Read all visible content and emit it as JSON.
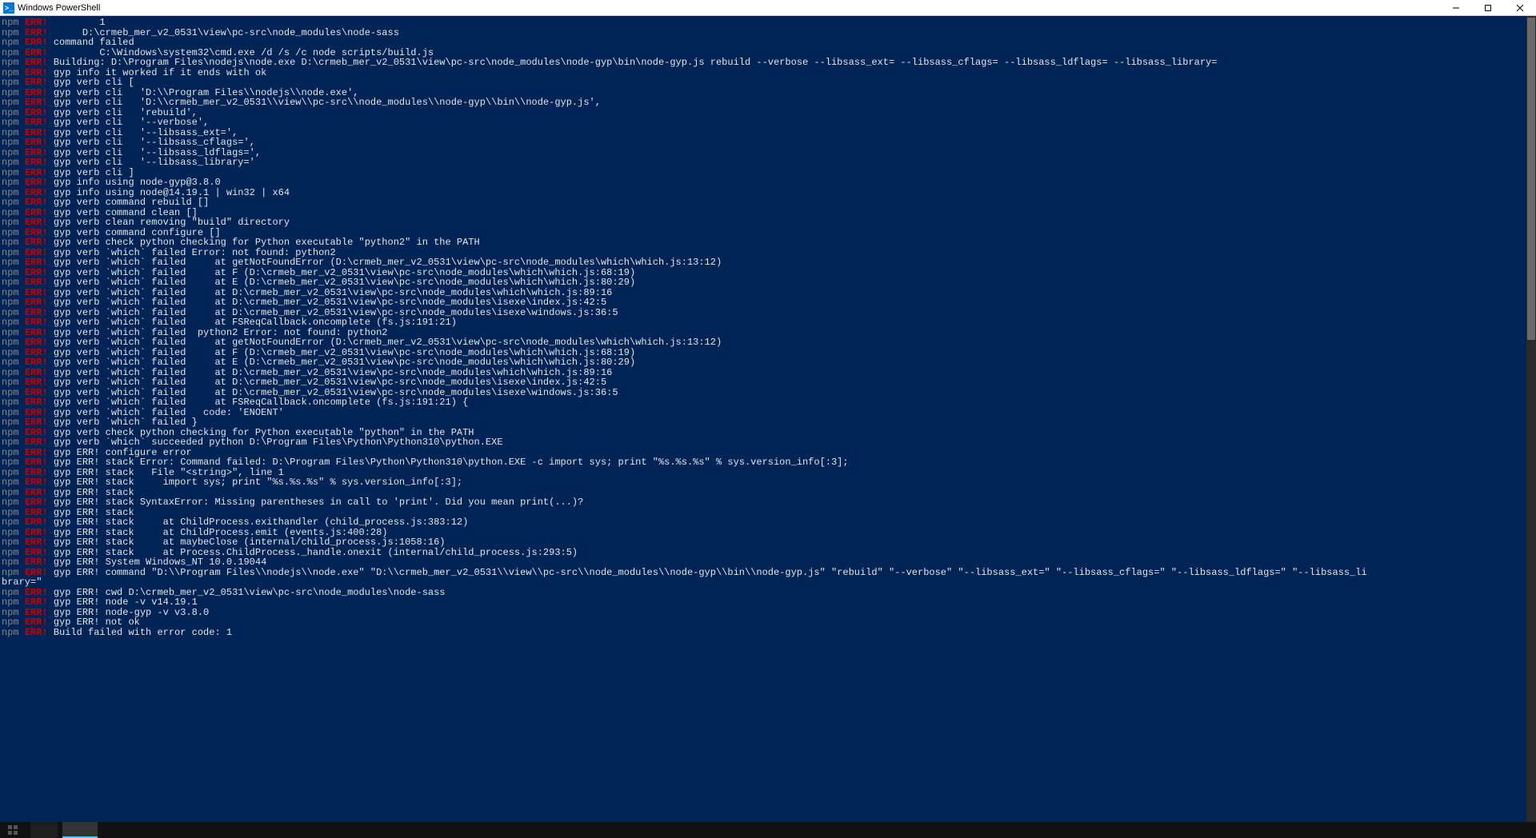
{
  "window": {
    "title": "Windows PowerShell",
    "icon_label": ">_"
  },
  "colors": {
    "terminal_bg": "#012456",
    "npm_gray": "#888888",
    "err_red": "#cc0000",
    "text": "#e5e5e5"
  },
  "prefix": {
    "npm": "npm",
    "err": "ERR!"
  },
  "lines": [
    {
      "t": "npmerr",
      "body": "         1"
    },
    {
      "t": "npmerr",
      "body": "      D:\\crmeb_mer_v2_0531\\view\\pc-src\\node_modules\\node-sass"
    },
    {
      "t": "npmerr",
      "body": " command failed"
    },
    {
      "t": "npmerr",
      "body": "         C:\\Windows\\system32\\cmd.exe /d /s /c node scripts/build.js"
    },
    {
      "t": "npmerr",
      "body": " Building: D:\\Program Files\\nodejs\\node.exe D:\\crmeb_mer_v2_0531\\view\\pc-src\\node_modules\\node-gyp\\bin\\node-gyp.js rebuild --verbose --libsass_ext= --libsass_cflags= --libsass_ldflags= --libsass_library="
    },
    {
      "t": "npmerr",
      "body": " gyp info it worked if it ends with ok"
    },
    {
      "t": "npmerr",
      "body": " gyp verb cli ["
    },
    {
      "t": "npmerr",
      "body": " gyp verb cli   'D:\\\\Program Files\\\\nodejs\\\\node.exe',"
    },
    {
      "t": "npmerr",
      "body": " gyp verb cli   'D:\\\\crmeb_mer_v2_0531\\\\view\\\\pc-src\\\\node_modules\\\\node-gyp\\\\bin\\\\node-gyp.js',"
    },
    {
      "t": "npmerr",
      "body": " gyp verb cli   'rebuild',"
    },
    {
      "t": "npmerr",
      "body": " gyp verb cli   '--verbose',"
    },
    {
      "t": "npmerr",
      "body": " gyp verb cli   '--libsass_ext=',"
    },
    {
      "t": "npmerr",
      "body": " gyp verb cli   '--libsass_cflags=',"
    },
    {
      "t": "npmerr",
      "body": " gyp verb cli   '--libsass_ldflags=',"
    },
    {
      "t": "npmerr",
      "body": " gyp verb cli   '--libsass_library='"
    },
    {
      "t": "npmerr",
      "body": " gyp verb cli ]"
    },
    {
      "t": "npmerr",
      "body": " gyp info using node-gyp@3.8.0"
    },
    {
      "t": "npmerr",
      "body": " gyp info using node@14.19.1 | win32 | x64"
    },
    {
      "t": "npmerr",
      "body": " gyp verb command rebuild []"
    },
    {
      "t": "npmerr",
      "body": " gyp verb command clean []"
    },
    {
      "t": "npmerr",
      "body": " gyp verb clean removing \"build\" directory"
    },
    {
      "t": "npmerr",
      "body": " gyp verb command configure []"
    },
    {
      "t": "npmerr",
      "body": " gyp verb check python checking for Python executable \"python2\" in the PATH"
    },
    {
      "t": "npmerr",
      "body": " gyp verb `which` failed Error: not found: python2"
    },
    {
      "t": "npmerr",
      "body": " gyp verb `which` failed     at getNotFoundError (D:\\crmeb_mer_v2_0531\\view\\pc-src\\node_modules\\which\\which.js:13:12)"
    },
    {
      "t": "npmerr",
      "body": " gyp verb `which` failed     at F (D:\\crmeb_mer_v2_0531\\view\\pc-src\\node_modules\\which\\which.js:68:19)"
    },
    {
      "t": "npmerr",
      "body": " gyp verb `which` failed     at E (D:\\crmeb_mer_v2_0531\\view\\pc-src\\node_modules\\which\\which.js:80:29)"
    },
    {
      "t": "npmerr",
      "body": " gyp verb `which` failed     at D:\\crmeb_mer_v2_0531\\view\\pc-src\\node_modules\\which\\which.js:89:16"
    },
    {
      "t": "npmerr",
      "body": " gyp verb `which` failed     at D:\\crmeb_mer_v2_0531\\view\\pc-src\\node_modules\\isexe\\index.js:42:5"
    },
    {
      "t": "npmerr",
      "body": " gyp verb `which` failed     at D:\\crmeb_mer_v2_0531\\view\\pc-src\\node_modules\\isexe\\windows.js:36:5"
    },
    {
      "t": "npmerr",
      "body": " gyp verb `which` failed     at FSReqCallback.oncomplete (fs.js:191:21)"
    },
    {
      "t": "npmerr",
      "body": " gyp verb `which` failed  python2 Error: not found: python2"
    },
    {
      "t": "npmerr",
      "body": " gyp verb `which` failed     at getNotFoundError (D:\\crmeb_mer_v2_0531\\view\\pc-src\\node_modules\\which\\which.js:13:12)"
    },
    {
      "t": "npmerr",
      "body": " gyp verb `which` failed     at F (D:\\crmeb_mer_v2_0531\\view\\pc-src\\node_modules\\which\\which.js:68:19)"
    },
    {
      "t": "npmerr",
      "body": " gyp verb `which` failed     at E (D:\\crmeb_mer_v2_0531\\view\\pc-src\\node_modules\\which\\which.js:80:29)"
    },
    {
      "t": "npmerr",
      "body": " gyp verb `which` failed     at D:\\crmeb_mer_v2_0531\\view\\pc-src\\node_modules\\which\\which.js:89:16"
    },
    {
      "t": "npmerr",
      "body": " gyp verb `which` failed     at D:\\crmeb_mer_v2_0531\\view\\pc-src\\node_modules\\isexe\\index.js:42:5"
    },
    {
      "t": "npmerr",
      "body": " gyp verb `which` failed     at D:\\crmeb_mer_v2_0531\\view\\pc-src\\node_modules\\isexe\\windows.js:36:5"
    },
    {
      "t": "npmerr",
      "body": " gyp verb `which` failed     at FSReqCallback.oncomplete (fs.js:191:21) {"
    },
    {
      "t": "npmerr",
      "body": " gyp verb `which` failed   code: 'ENOENT'"
    },
    {
      "t": "npmerr",
      "body": " gyp verb `which` failed }"
    },
    {
      "t": "npmerr",
      "body": " gyp verb check python checking for Python executable \"python\" in the PATH"
    },
    {
      "t": "npmerr",
      "body": " gyp verb `which` succeeded python D:\\Program Files\\Python\\Python310\\python.EXE"
    },
    {
      "t": "npmerr",
      "body": " gyp ERR! configure error"
    },
    {
      "t": "npmerr",
      "body": " gyp ERR! stack Error: Command failed: D:\\Program Files\\Python\\Python310\\python.EXE -c import sys; print \"%s.%s.%s\" % sys.version_info[:3];"
    },
    {
      "t": "npmerr",
      "body": " gyp ERR! stack   File \"<string>\", line 1"
    },
    {
      "t": "npmerr",
      "body": " gyp ERR! stack     import sys; print \"%s.%s.%s\" % sys.version_info[:3];"
    },
    {
      "t": "npmerr",
      "body": " gyp ERR! stack"
    },
    {
      "t": "npmerr",
      "body": " gyp ERR! stack SyntaxError: Missing parentheses in call to 'print'. Did you mean print(...)?"
    },
    {
      "t": "npmerr",
      "body": " gyp ERR! stack"
    },
    {
      "t": "npmerr",
      "body": " gyp ERR! stack     at ChildProcess.exithandler (child_process.js:383:12)"
    },
    {
      "t": "npmerr",
      "body": " gyp ERR! stack     at ChildProcess.emit (events.js:400:28)"
    },
    {
      "t": "npmerr",
      "body": " gyp ERR! stack     at maybeClose (internal/child_process.js:1058:16)"
    },
    {
      "t": "npmerr",
      "body": " gyp ERR! stack     at Process.ChildProcess._handle.onexit (internal/child_process.js:293:5)"
    },
    {
      "t": "npmerr",
      "body": " gyp ERR! System Windows_NT 10.0.19044"
    },
    {
      "t": "npmerr",
      "body": " gyp ERR! command \"D:\\\\Program Files\\\\nodejs\\\\node.exe\" \"D:\\\\crmeb_mer_v2_0531\\\\view\\\\pc-src\\\\node_modules\\\\node-gyp\\\\bin\\\\node-gyp.js\" \"rebuild\" \"--verbose\" \"--libsass_ext=\" \"--libsass_cflags=\" \"--libsass_ldflags=\" \"--libsass_li"
    },
    {
      "t": "plain",
      "body": "brary=\""
    },
    {
      "t": "npmerr",
      "body": " gyp ERR! cwd D:\\crmeb_mer_v2_0531\\view\\pc-src\\node_modules\\node-sass"
    },
    {
      "t": "npmerr",
      "body": " gyp ERR! node -v v14.19.1"
    },
    {
      "t": "npmerr",
      "body": " gyp ERR! node-gyp -v v3.8.0"
    },
    {
      "t": "npmerr",
      "body": " gyp ERR! not ok"
    },
    {
      "t": "npmerr",
      "body": " Build failed with error code: 1"
    }
  ]
}
